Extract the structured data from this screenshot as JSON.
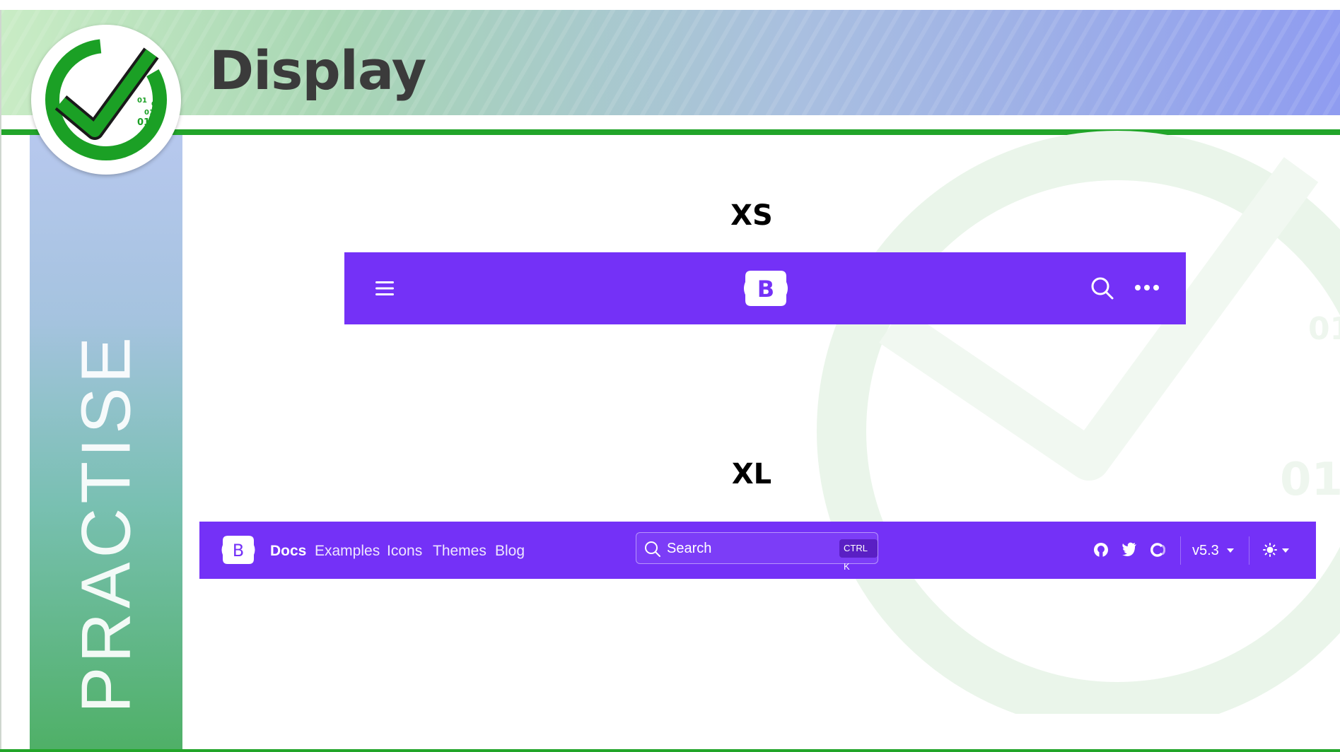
{
  "slide": {
    "title": "Display",
    "sidebar_text": "PRACTISE",
    "logo_digits": [
      "01",
      "01",
      "01",
      "01"
    ]
  },
  "sections": {
    "xs_label": "XS",
    "xl_label": "XL"
  },
  "xs_navbar": {
    "brand_letter": "B",
    "icons": [
      "menu-icon",
      "bootstrap-logo-icon",
      "search-icon",
      "more-icon"
    ]
  },
  "xl_navbar": {
    "brand_letter": "B",
    "links": [
      "Docs",
      "Examples",
      "Icons",
      "Themes",
      "Blog"
    ],
    "active_link": "Docs",
    "search": {
      "placeholder": "Search",
      "shortcut": "CTRL K"
    },
    "version": "v5.3",
    "icons": [
      "github-icon",
      "twitter-icon",
      "opencollective-icon",
      "theme-toggle-icon"
    ]
  },
  "colors": {
    "navbar": "#7431f7",
    "accent_green": "#22a52a",
    "title_text": "#3b3b3b"
  }
}
